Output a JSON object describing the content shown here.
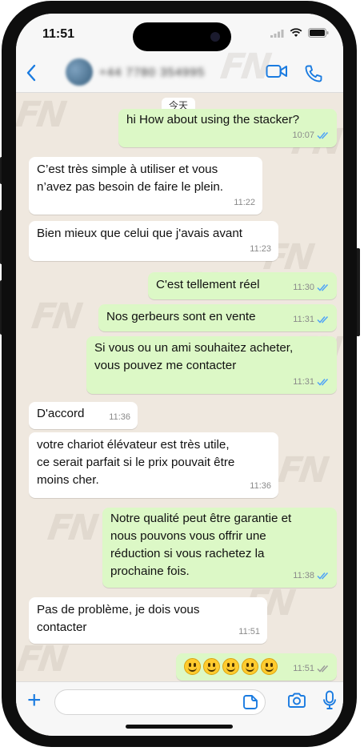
{
  "status_bar": {
    "time": "11:51"
  },
  "header": {
    "contact_name": "+44 7780 354995",
    "back_icon": "chevron-left-icon",
    "video_call_icon": "video-camera-icon",
    "voice_call_icon": "phone-icon"
  },
  "chat": {
    "date_chip": "今天",
    "messages": [
      {
        "dir": "out",
        "text": "hi  How about using the stacker?",
        "time": "10:07",
        "read": true
      },
      {
        "dir": "in",
        "text": "C’est très simple à utiliser et vous\nn’avez pas besoin de faire le plein.",
        "time": "11:22"
      },
      {
        "dir": "in",
        "text": "Bien mieux que celui que j'avais avant",
        "time": "11:23"
      },
      {
        "dir": "out",
        "text": "C'est tellement réel",
        "time": "11:30",
        "read": true
      },
      {
        "dir": "out",
        "text": "Nos gerbeurs sont en vente",
        "time": "11:31",
        "read": true
      },
      {
        "dir": "out",
        "text": "Si vous ou un ami souhaitez acheter,\nvous pouvez me contacter",
        "time": "11:31",
        "read": true
      },
      {
        "dir": "in",
        "text": "D'accord",
        "time": "11:36"
      },
      {
        "dir": "in",
        "text": "votre chariot élévateur est très utile,\nce serait parfait si le prix pouvait être\nmoins cher.",
        "time": "11:36"
      },
      {
        "dir": "out",
        "text": "Notre qualité peut être garantie et\nnous pouvons vous offrir une\nréduction si vous rachetez la\nprochaine fois.",
        "time": "11:38",
        "read": true
      },
      {
        "dir": "in",
        "text": "Pas de problème, je dois vous\ncontacter",
        "time": "11:51"
      },
      {
        "dir": "out",
        "emoji_count": 5,
        "emoji": "grinning-face-emoji",
        "time": "11:51",
        "read": false
      }
    ]
  },
  "watermark": "FN",
  "input_bar": {
    "plus_icon": "plus-icon",
    "sticker_icon": "sticker-icon",
    "camera_icon": "camera-icon",
    "mic_icon": "microphone-icon"
  },
  "colors": {
    "incoming_bubble": "#ffffff",
    "outgoing_bubble": "#dcf8c6",
    "accent": "#1a7be0",
    "read_ticks": "#4fa3f7",
    "chat_background": "#efe8df"
  }
}
